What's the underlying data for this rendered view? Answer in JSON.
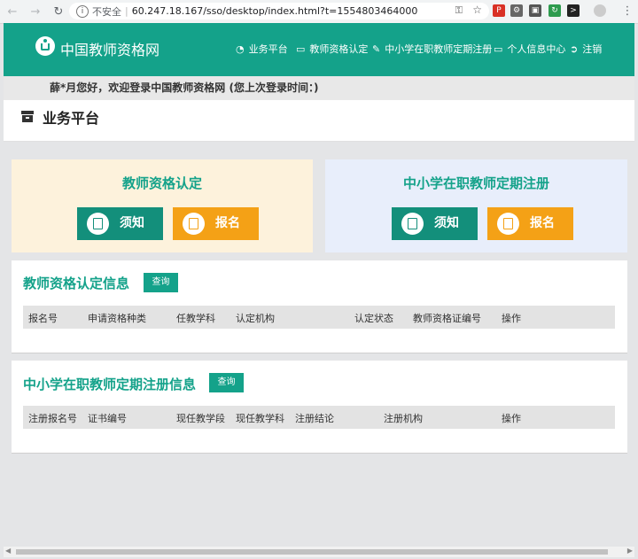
{
  "browser": {
    "insecure_label": "不安全",
    "url": "60.247.18.167/sso/desktop/index.html?t=1554803464000",
    "back_icon": "arrow-left-icon",
    "forward_icon": "arrow-right-icon",
    "reload_icon": "reload-icon"
  },
  "header": {
    "site_name": "中国教师资格网",
    "brand_color": "#14a28a",
    "menu": [
      {
        "icon": "dashboard-icon",
        "label": "业务平台"
      },
      {
        "icon": "monitor-icon",
        "label": "教师资格认定"
      },
      {
        "icon": "edit-icon",
        "label": "中小学在职教师定期注册"
      },
      {
        "icon": "monitor-icon",
        "label": "个人信息中心"
      },
      {
        "icon": "logout-icon",
        "label": "注销"
      }
    ]
  },
  "welcome": {
    "text": "薛*月您好，欢迎登录中国教师资格网 (您上次登录时间：)"
  },
  "page": {
    "title": "业务平台"
  },
  "cards": [
    {
      "title": "教师资格认定",
      "notice_label": "须知",
      "apply_label": "报名",
      "bg": "#fdf2dc"
    },
    {
      "title": "中小学在职教师定期注册",
      "notice_label": "须知",
      "apply_label": "报名",
      "bg": "#e8eefb"
    }
  ],
  "cert_section": {
    "title": "教师资格认定信息",
    "query_label": "查询",
    "columns": [
      "报名号",
      "申请资格种类",
      "任教学科",
      "认定机构",
      "认定状态",
      "教师资格证编号",
      "操作"
    ]
  },
  "register_section": {
    "title": "中小学在职教师定期注册信息",
    "query_label": "查询",
    "columns": [
      "注册报名号",
      "证书编号",
      "现任教学段",
      "现任教学科",
      "注册结论",
      "注册机构",
      "操作"
    ]
  }
}
